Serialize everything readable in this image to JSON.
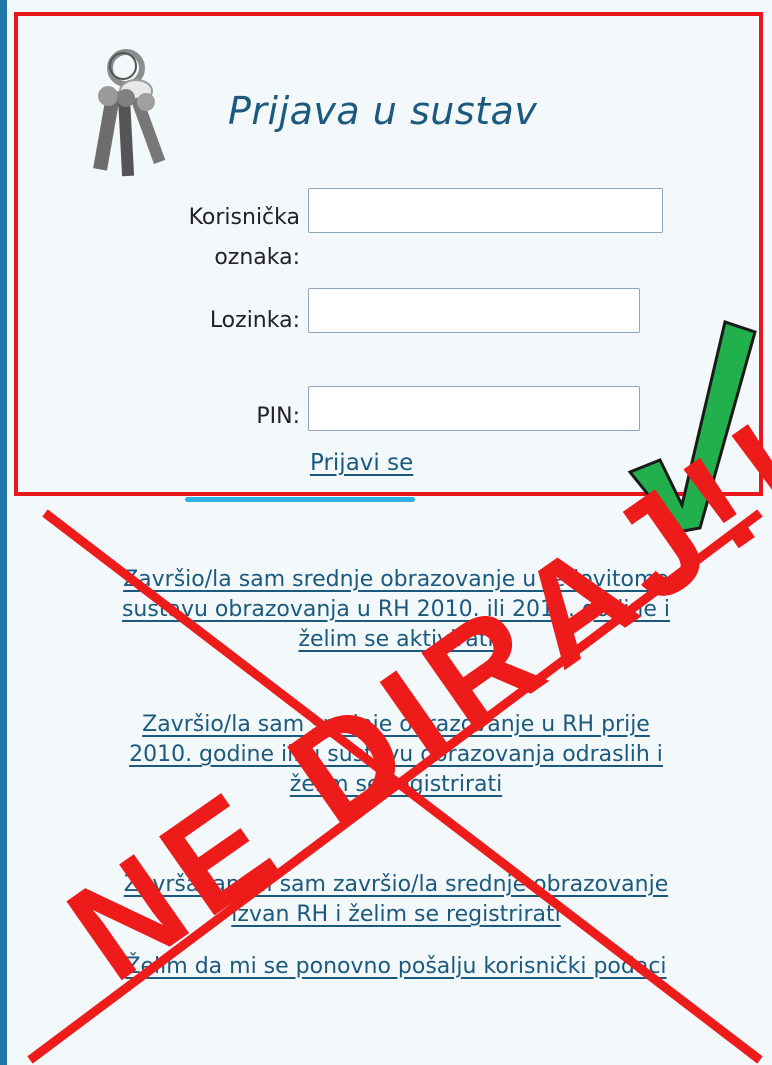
{
  "login": {
    "title": "Prijava u sustav",
    "username_label_line1": "Korisnička",
    "username_label_line2": "oznaka:",
    "username_value": "",
    "password_label": "Lozinka:",
    "password_value": "",
    "pin_label": "PIN:",
    "pin_value": "",
    "submit_label": "Prijavi se"
  },
  "links": [
    {
      "line1": "Završio/la sam srednje obrazovanje u redovitome",
      "line2": "sustavu obrazovanja u RH 2010. ili 2011. godine i",
      "line3": "želim se aktivirati"
    },
    {
      "line1": "Završio/la sam srednje obrazovanje u RH prije",
      "line2": "2010. godine ili u sustavu obrazovanja odraslih i",
      "line3": "želim se registrirati"
    },
    {
      "line1": "Završavam ili sam završio/la srednje obrazovanje",
      "line2": "izvan RH i želim se registrirati"
    },
    {
      "line1": "Želim da mi se ponovno pošalju korisnički podaci"
    }
  ],
  "annotation": {
    "text": "NE DIRAJ!!!",
    "cross_color": "#ee1b1b",
    "check_color": "#22b04c",
    "box_color": "#e8171e"
  }
}
